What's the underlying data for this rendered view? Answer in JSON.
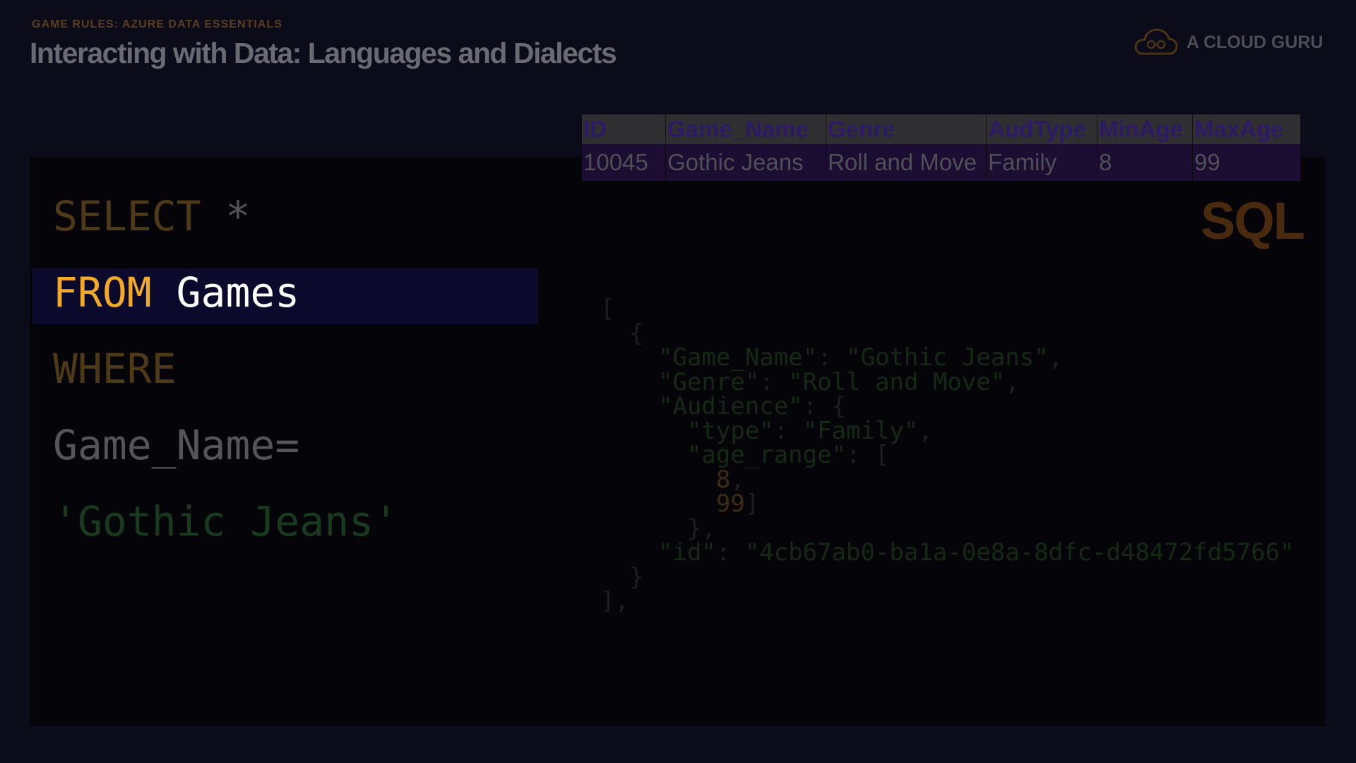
{
  "header": {
    "eyebrow": "GAME RULES: AZURE DATA ESSENTIALS",
    "title": "Interacting with Data: Languages and Dialects"
  },
  "brand": {
    "name": "A CLOUD GURU",
    "icon": "cloud-logo-icon"
  },
  "query": {
    "select_kw": "SELECT",
    "select_star": " *",
    "from_kw": "FROM",
    "from_table": " Games",
    "where_kw": "WHERE",
    "condition": "Game_Name=",
    "value": "'Gothic Jeans'"
  },
  "result_table": {
    "headers": [
      "ID",
      "Game_Name",
      "Genre",
      "AudType",
      "MinAge",
      "MaxAge"
    ],
    "rows": [
      [
        "10045",
        "Gothic Jeans",
        "Roll and Move",
        "Family",
        "8",
        "99"
      ]
    ]
  },
  "sql_label": "SQL",
  "json_doc": {
    "open_array": "[",
    "open_obj": "  {",
    "key_game_name": "\"Game_Name\"",
    "val_game_name": "\"Gothic Jeans\"",
    "key_genre": "\"Genre\"",
    "val_genre": "\"Roll and Move\"",
    "key_audience": "\"Audience\"",
    "key_type": "\"type\"",
    "val_type": "\"Family\"",
    "key_age_range": "\"age_range\"",
    "age_min": "8",
    "age_max": "99",
    "key_id": "\"id\"",
    "val_id": "\"4cb67ab0-ba1a-0e8a-8dfc-d48472fd5766\"",
    "close_obj": "  }",
    "close_array": "],"
  },
  "colors": {
    "keyword": "#f3a928",
    "highlight": "#0b0a2c",
    "background": "#0c0b1a"
  }
}
